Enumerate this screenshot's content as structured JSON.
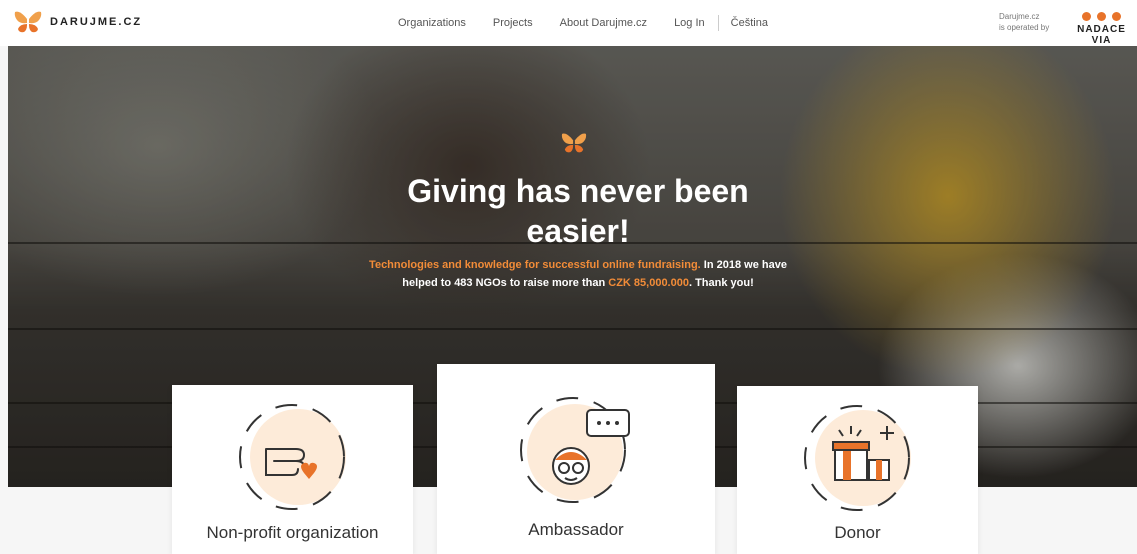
{
  "header": {
    "logo_text": "DARUJME.CZ",
    "nav": [
      "Organizations",
      "Projects",
      "About Darujme.cz",
      "Log In"
    ],
    "language": "Čeština",
    "operated_line1": "Darujme.cz",
    "operated_line2": "is operated by",
    "partner": "NADACE VIA"
  },
  "hero": {
    "title": "Giving has never been easier!",
    "text_highlight": "Technologies and knowledge for successful online fundraising.",
    "text_1": " In 2018 we have helped to 483 NGOs to raise more than ",
    "amount": "CZK 85,000.000",
    "text_2": ". Thank you!"
  },
  "cards": [
    {
      "title": "Non-profit organization",
      "icon": "hand-heart-icon"
    },
    {
      "title": "Ambassador",
      "icon": "ambassador-icon"
    },
    {
      "title": "Donor",
      "icon": "gift-icon"
    }
  ],
  "colors": {
    "accent": "#e8732a",
    "icon_bg": "#fdebd9"
  }
}
